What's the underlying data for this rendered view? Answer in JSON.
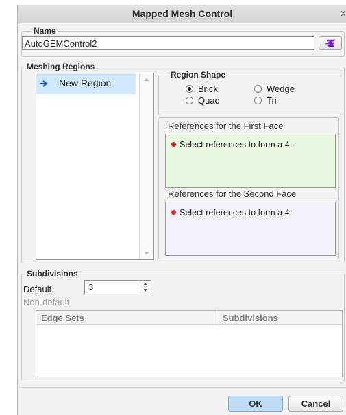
{
  "window": {
    "title": "Mapped Mesh Control",
    "close_glyph": "x"
  },
  "name_group": {
    "legend": "Name",
    "value": "AutoGEMControl2",
    "picker_icon": "color-swatch-icon"
  },
  "meshing_regions": {
    "legend": "Meshing Regions",
    "items": [
      {
        "label": "New Region",
        "icon": "arrow-right-icon",
        "selected": true
      }
    ],
    "region_shape": {
      "legend": "Region Shape",
      "options": [
        {
          "label": "Brick",
          "selected": true
        },
        {
          "label": "Wedge",
          "selected": false
        },
        {
          "label": "Quad",
          "selected": false
        },
        {
          "label": "Tri",
          "selected": false
        }
      ]
    },
    "first_face": {
      "label": "References for the First Face",
      "item": "Select references to form a 4-",
      "bg": "#e8f7df"
    },
    "second_face": {
      "label": "References for the Second Face",
      "item": "Select references to form a 4-",
      "bg": "#f4f1fb"
    }
  },
  "subdivisions": {
    "legend": "Subdivisions",
    "default_label": "Default",
    "default_value": "3",
    "nondefault_label": "Non-default",
    "columns": [
      "Edge Sets",
      "Subdivisions"
    ]
  },
  "buttons": {
    "ok": "OK",
    "cancel": "Cancel"
  },
  "colors": {
    "selection": "#cfe8fb",
    "ok_button": "#bfdcf6",
    "status_dot": "#e01b1b"
  }
}
